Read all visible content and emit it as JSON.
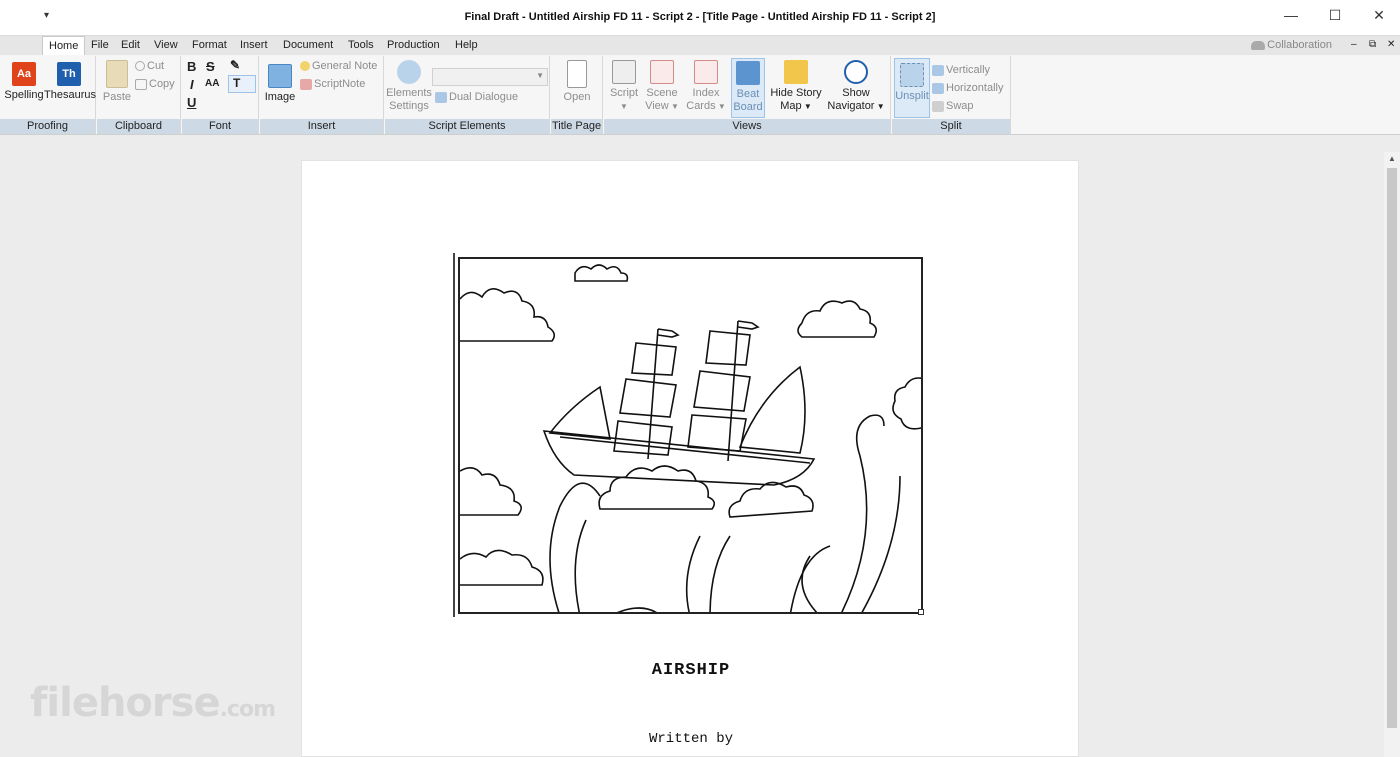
{
  "window": {
    "title": "Final Draft - Untitled Airship FD 11 - Script 2 - [Title Page - Untitled Airship FD 11 - Script 2]",
    "qat_glyph": "▾",
    "minimize": "—",
    "maximize": "☐",
    "close": "✕"
  },
  "menu": {
    "items": [
      "Home",
      "File",
      "Edit",
      "View",
      "Format",
      "Insert",
      "Document",
      "Tools",
      "Production",
      "Help"
    ],
    "collaboration": "Collaboration",
    "ribbon_min": "–",
    "ribbon_restore": "⧉",
    "ribbon_close": "✕"
  },
  "ribbon": {
    "proofing": {
      "label": "Proofing",
      "spelling": "Spelling",
      "thesaurus": "Thesaurus",
      "spelling_icon_text": "Aa",
      "thesaurus_icon_text": "Th"
    },
    "clipboard": {
      "label": "Clipboard",
      "paste": "Paste",
      "cut": "Cut",
      "copy": "Copy"
    },
    "font": {
      "label": "Font",
      "bold": "B",
      "strike": "S",
      "italic": "I",
      "case": "AA",
      "underline": "U",
      "text_color": "T"
    },
    "insert": {
      "label": "Insert",
      "image": "Image",
      "general_note": "General Note",
      "scriptnote": "ScriptNote"
    },
    "script_elements": {
      "label": "Script Elements",
      "elements": "Elements",
      "settings": "Settings",
      "dual_dialogue": "Dual Dialogue"
    },
    "title_page": {
      "label": "Title Page",
      "open": "Open"
    },
    "views": {
      "label": "Views",
      "script": "Script",
      "scene": "Scene",
      "scene2": "View",
      "index": "Index",
      "index2": "Cards",
      "beat": "Beat",
      "beat2": "Board",
      "hide_story": "Hide Story",
      "hide_story2": "Map",
      "show": "Show",
      "show2": "Navigator"
    },
    "split": {
      "label": "Split",
      "unsplit": "Unsplit",
      "vertically": "Vertically",
      "horizontally": "Horizontally",
      "swap": "Swap"
    }
  },
  "document": {
    "title": "AIRSHIP",
    "written_by": "Written by"
  },
  "watermark": {
    "main": "filehorse",
    "suffix": ".com"
  }
}
